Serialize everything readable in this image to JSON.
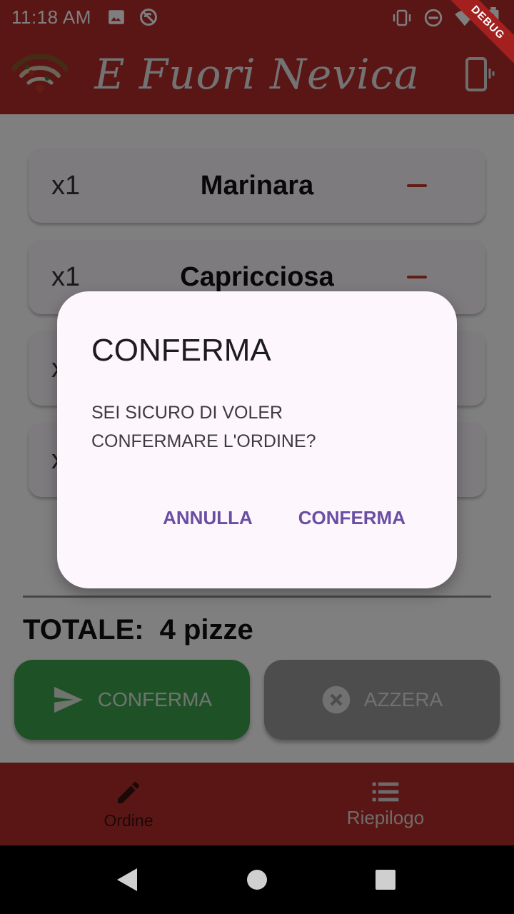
{
  "status_bar": {
    "time": "11:18 AM",
    "debug_label": "DEBUG"
  },
  "app_bar": {
    "title": "E Fuori Nevica"
  },
  "order_items": [
    {
      "qty": "x1",
      "name": "Marinara"
    },
    {
      "qty": "x1",
      "name": "Capricciosa"
    },
    {
      "qty": "x",
      "name": ""
    },
    {
      "qty": "x",
      "name": ""
    }
  ],
  "summary": {
    "total_label": "TOTALE:",
    "total_value": "4 pizze"
  },
  "buttons": {
    "confirm_label": "CONFERMA",
    "reset_label": "AZZERA"
  },
  "bottom_nav": {
    "ordine_label": "Ordine",
    "riepilogo_label": "Riepilogo"
  },
  "dialog": {
    "title": "CONFERMA",
    "message": "SEI SICURO DI VOLER CONFERMARE L'ORDINE?",
    "cancel_label": "ANNULLA",
    "confirm_label": "CONFERMA"
  },
  "colors": {
    "primary": "#b32d2b",
    "confirm_button": "#3fa34d",
    "dialog_action": "#6a4ea3"
  }
}
